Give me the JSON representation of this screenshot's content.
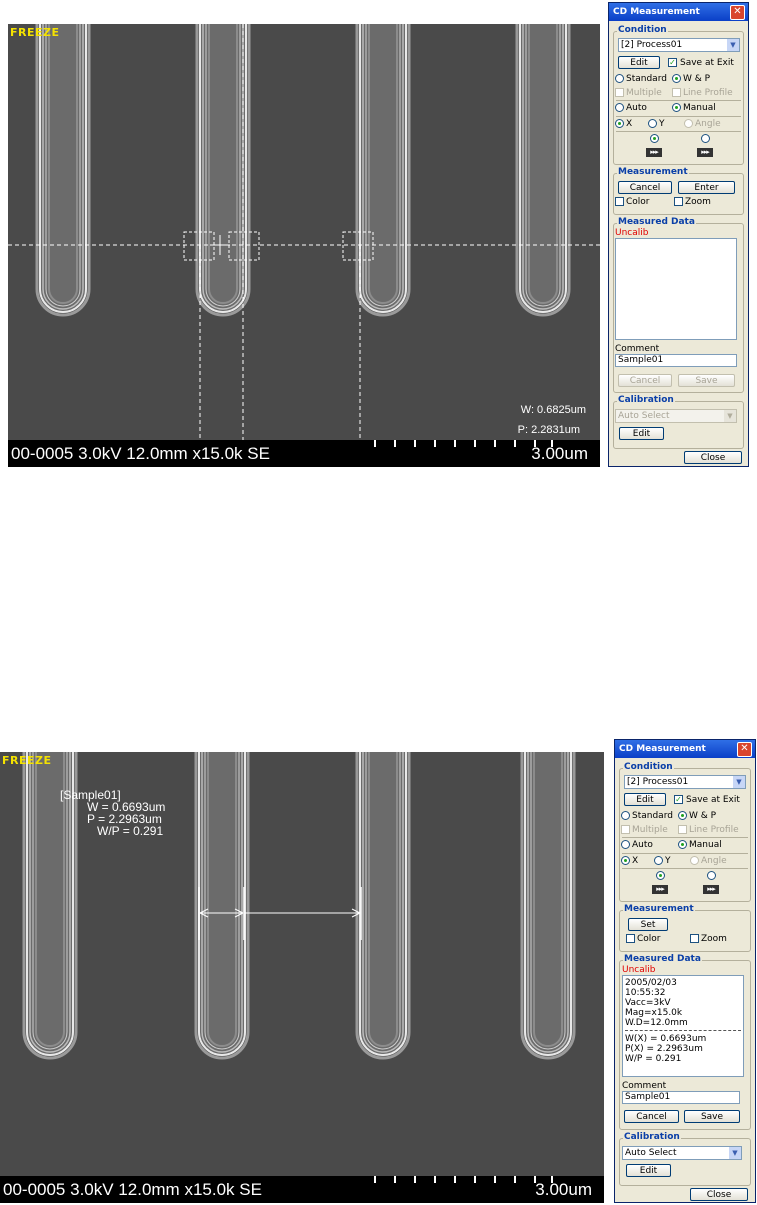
{
  "sem_top": {
    "freeze": "FREEZE",
    "info": "00-0005 3.0kV 12.0mm x15.0k SE",
    "scale": "3.00um",
    "readout_w": "W: 0.6825um",
    "readout_p": "P: 2.2831um"
  },
  "sem_bottom": {
    "freeze": "FREEZE",
    "info": "00-0005 3.0kV 12.0mm x15.0k SE",
    "scale": "3.00um",
    "annotation": {
      "sample": "[Sample01]",
      "w": "W = 0.6693um",
      "p": "P = 2.2963um",
      "wp": "W/P = 0.291"
    }
  },
  "dialog_top": {
    "title": "CD Measurement",
    "close_glyph": "✕",
    "condition": "Condition",
    "process_select": "[2] Process01",
    "edit": "Edit",
    "save_at_exit": "Save at Exit",
    "standard": "Standard",
    "wp": "W & P",
    "multiple": "Multiple",
    "line_profile": "Line Profile",
    "auto": "Auto",
    "manual": "Manual",
    "x": "X",
    "y": "Y",
    "angle": "Angle",
    "measurement": "Measurement",
    "cancel": "Cancel",
    "enter": "Enter",
    "color": "Color",
    "zoom": "Zoom",
    "measured_data": "Measured Data",
    "uncalib": "Uncalib",
    "comment": "Comment",
    "comment_value": "Sample01",
    "cancel2": "Cancel",
    "save": "Save",
    "calibration": "Calibration",
    "calib_select": "Auto Select",
    "edit2": "Edit",
    "close": "Close"
  },
  "dialog_bottom": {
    "title": "CD Measurement",
    "close_glyph": "✕",
    "condition": "Condition",
    "process_select": "[2] Process01",
    "edit": "Edit",
    "save_at_exit": "Save at Exit",
    "standard": "Standard",
    "wp": "W & P",
    "multiple": "Multiple",
    "line_profile": "Line Profile",
    "auto": "Auto",
    "manual": "Manual",
    "x": "X",
    "y": "Y",
    "angle": "Angle",
    "measurement": "Measurement",
    "set": "Set",
    "color": "Color",
    "zoom": "Zoom",
    "measured_data": "Measured Data",
    "uncalib": "Uncalib",
    "data_lines_a": [
      "2005/02/03",
      "10:55:32",
      "Vacc=3kV",
      "Mag=x15.0k",
      "W.D=12.0mm"
    ],
    "data_lines_b": [
      "W(X) = 0.6693um",
      "P(X) = 2.2963um",
      "W/P = 0.291"
    ],
    "comment": "Comment",
    "comment_value": "Sample01",
    "cancel": "Cancel",
    "save": "Save",
    "calibration": "Calibration",
    "calib_select": "Auto Select",
    "edit2": "Edit",
    "close": "Close"
  },
  "colors": {
    "sem_bg": "#4a4a4a",
    "freeze": "#f4e200",
    "titlebar": "#0a3fc7",
    "group_title": "#0a3fa8",
    "uncalib": "#e00000"
  }
}
